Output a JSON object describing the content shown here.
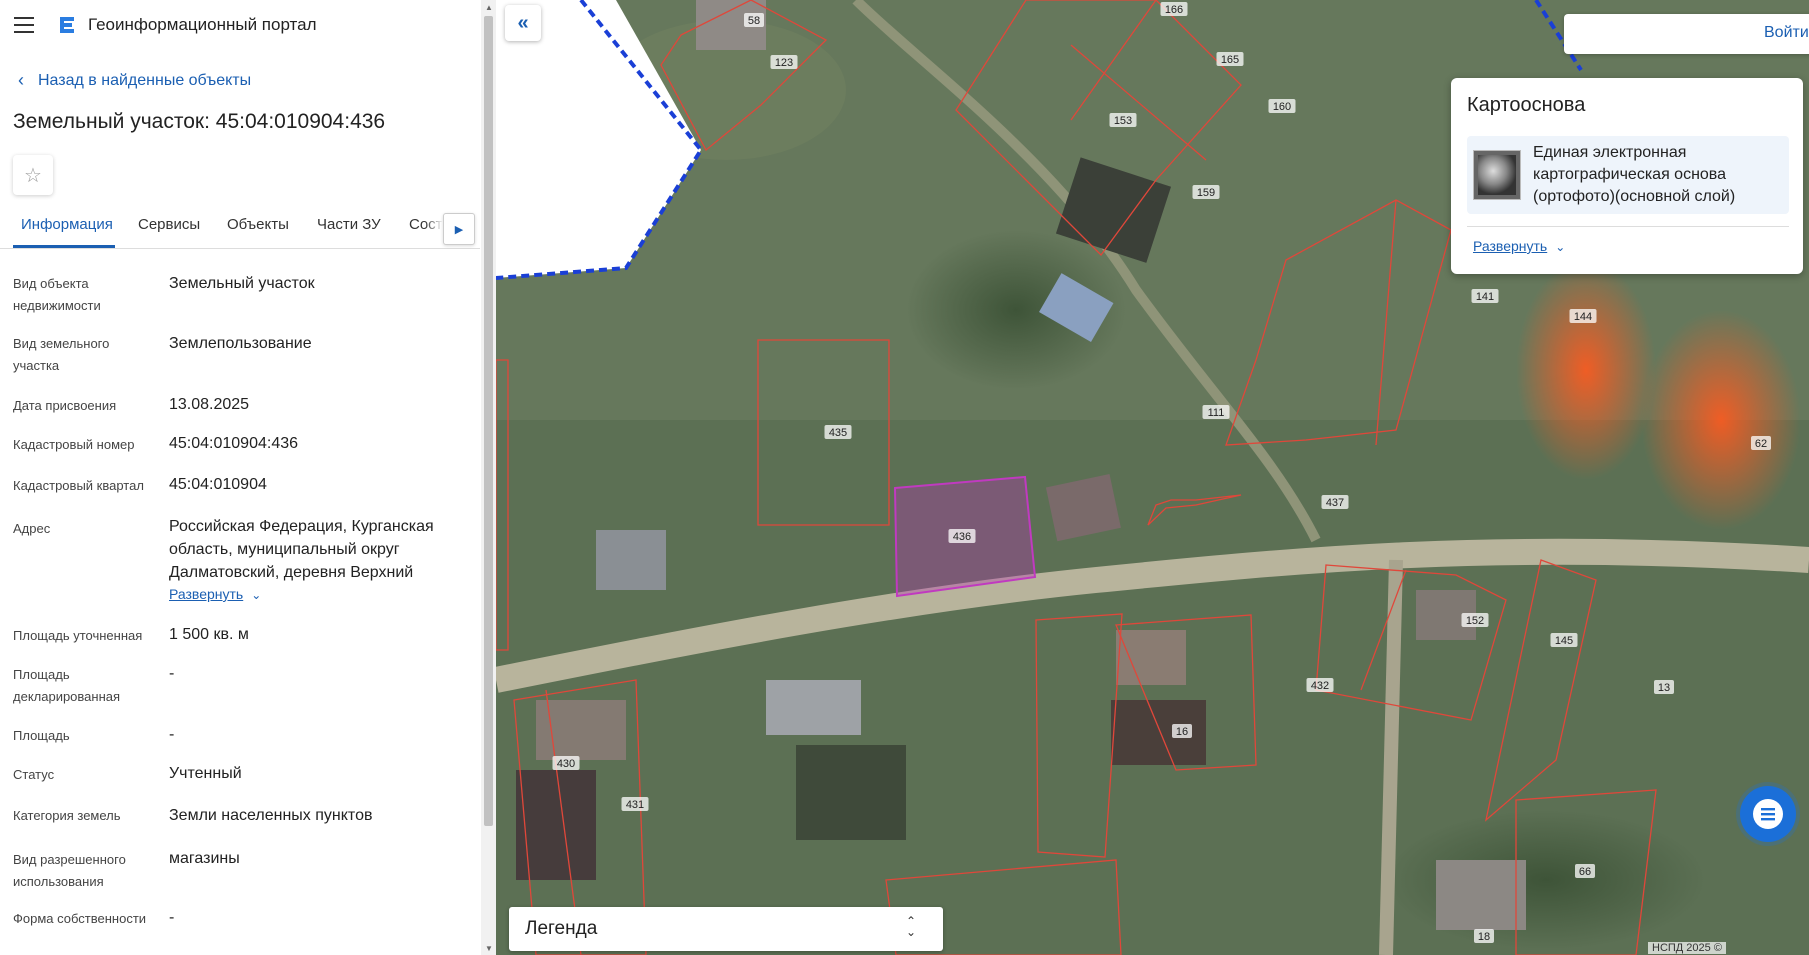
{
  "header": {
    "app_title": "Геоинформационный портал"
  },
  "nav": {
    "back_label": "Назад в найденные объекты"
  },
  "page": {
    "title": "Земельный участок: 45:04:010904:436"
  },
  "tabs": [
    {
      "label": "Информация",
      "active": true
    },
    {
      "label": "Сервисы"
    },
    {
      "label": "Объекты"
    },
    {
      "label": "Части ЗУ"
    },
    {
      "label": "Соста"
    }
  ],
  "properties": [
    {
      "label": "Вид объекта недвижимости",
      "value": "Земельный участок"
    },
    {
      "label": "Вид земельного участка",
      "value": "Землепользование"
    },
    {
      "label": "Дата присвоения",
      "value": "13.08.2025"
    },
    {
      "label": "Кадастровый номер",
      "value": "45:04:010904:436"
    },
    {
      "label": "Кадастровый квартал",
      "value": "45:04:010904"
    },
    {
      "label": "Адрес",
      "value": "Российская Федерация, Курганская область, муниципальный округ Далматовский, деревня Верхний"
    },
    {
      "label": "Площадь уточненная",
      "value": "1 500 кв. м"
    },
    {
      "label": "Площадь декларированная",
      "value": "-"
    },
    {
      "label": "Площадь",
      "value": "-"
    },
    {
      "label": "Статус",
      "value": "Учтенный"
    },
    {
      "label": "Категория земель",
      "value": "Земли населенных пунктов"
    },
    {
      "label": "Вид разрешенного использования",
      "value": "магазины"
    },
    {
      "label": "Форма собственности",
      "value": "-"
    }
  ],
  "address_expand_label": "Развернуть",
  "map": {
    "login_label": "Войти",
    "basemap": {
      "title": "Картооснова",
      "item_label": "Единая электронная картографическая основа (ортофото)(основной слой)",
      "expand_label": "Развернуть"
    },
    "legend_label": "Легенда",
    "attribution": "НСПД 2025 ©",
    "parcel_labels": [
      "58",
      "123",
      "166",
      "165",
      "153",
      "160",
      "159",
      "141",
      "144",
      "62",
      "111",
      "435",
      "436",
      "437",
      "152",
      "145",
      "13",
      "432",
      "16",
      "430",
      "431",
      "66",
      "18"
    ]
  },
  "colors": {
    "accent": "#1b5fb2",
    "parcel_outline": "#e0473a",
    "selected_parcel": "#b531b5",
    "boundary_dash": "#1a3fd6"
  }
}
